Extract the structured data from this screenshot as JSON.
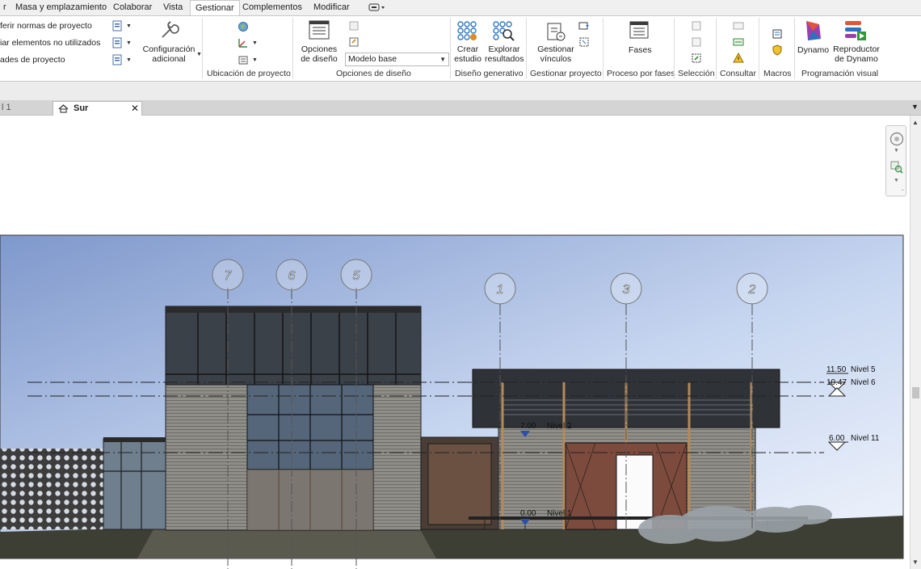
{
  "menu": {
    "tabs": [
      "Masa y emplazamiento",
      "Colaborar",
      "Vista",
      "Gestionar",
      "Complementos",
      "Modificar"
    ],
    "active_tab": "Gestionar"
  },
  "ribbon": {
    "settings_items": [
      "ferir normas de proyecto",
      "iar elementos no utilizados",
      "ades de proyecto"
    ],
    "config_label": "Configuración adicional",
    "location_label": "Ubicación de proyecto",
    "design_options_button": "Opciones de diseño",
    "design_option_value": "Modelo base",
    "design_options_label": "Opciones de diseño",
    "create_study": "Crear estudio",
    "explore_results": "Explorar resultados",
    "generative_label": "Diseño generativo",
    "manage_links": "Gestionar vínculos",
    "manage_project_label": "Gestionar proyecto",
    "phases_button": "Fases",
    "phases_label": "Proceso por fases",
    "selection_label": "Selección",
    "inquiry_label": "Consultar",
    "macros_label": "Macros",
    "dynamo": "Dynamo",
    "dynamo_player": "Reproductor de Dynamo",
    "visual_programming_label": "Programación visual"
  },
  "view_tabs": {
    "prev_tab": "l 1",
    "active_tab": "Sur",
    "close_glyph": "✕"
  },
  "elevation": {
    "grids": [
      "7",
      "6",
      "5",
      "1",
      "3",
      "2"
    ],
    "levels": [
      {
        "value": "11.50",
        "name": "Nivel 5"
      },
      {
        "value": "10.47",
        "name": "Nivel 6"
      },
      {
        "value": "6.00",
        "name": "Nivel 11"
      },
      {
        "value": "7.00",
        "name": "Nivel 2"
      },
      {
        "value": "0.00",
        "name": "Nivel 1"
      }
    ]
  },
  "colors": {
    "ribbon_bg": "#ffffff",
    "tab_bar_bg": "#d4d4d4",
    "sky_top": "#8ea7d6",
    "sky_bottom": "#e6eefb"
  }
}
